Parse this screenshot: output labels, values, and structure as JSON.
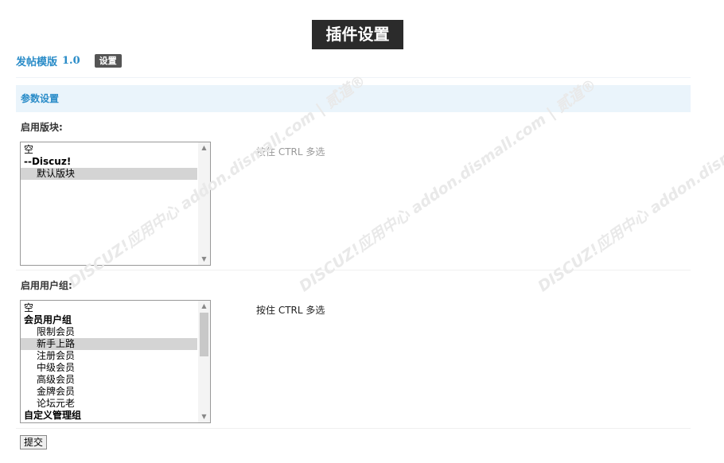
{
  "page_title": "插件设置",
  "plugin": {
    "name": "发帖模版",
    "version": "1.0",
    "settings_button": "设置"
  },
  "section_title": "参数设置",
  "forum_field": {
    "label": "启用版块:",
    "hint": "按住 CTRL 多选",
    "options": [
      {
        "text": "空",
        "group": false,
        "indent": false,
        "selected": false
      },
      {
        "text": "--Discuz!",
        "group": true,
        "indent": false,
        "selected": false
      },
      {
        "text": "默认版块",
        "group": false,
        "indent": true,
        "selected": true
      }
    ]
  },
  "usergroup_field": {
    "label": "启用用户组:",
    "hint": "按住 CTRL 多选",
    "options": [
      {
        "text": "空",
        "group": false,
        "indent": false,
        "selected": false
      },
      {
        "text": "会员用户组",
        "group": true,
        "indent": false,
        "selected": false
      },
      {
        "text": "限制会员",
        "group": false,
        "indent": true,
        "selected": false
      },
      {
        "text": "新手上路",
        "group": false,
        "indent": true,
        "selected": true
      },
      {
        "text": "注册会员",
        "group": false,
        "indent": true,
        "selected": false
      },
      {
        "text": "中级会员",
        "group": false,
        "indent": true,
        "selected": false
      },
      {
        "text": "高级会员",
        "group": false,
        "indent": true,
        "selected": false
      },
      {
        "text": "金牌会员",
        "group": false,
        "indent": true,
        "selected": false
      },
      {
        "text": "论坛元老",
        "group": false,
        "indent": true,
        "selected": false
      },
      {
        "text": "自定义管理组",
        "group": true,
        "indent": false,
        "selected": false
      }
    ]
  },
  "submit_label": "提交",
  "watermark_text": "DISCUZ!应用中心 addon.dismall.com | 贰道®"
}
